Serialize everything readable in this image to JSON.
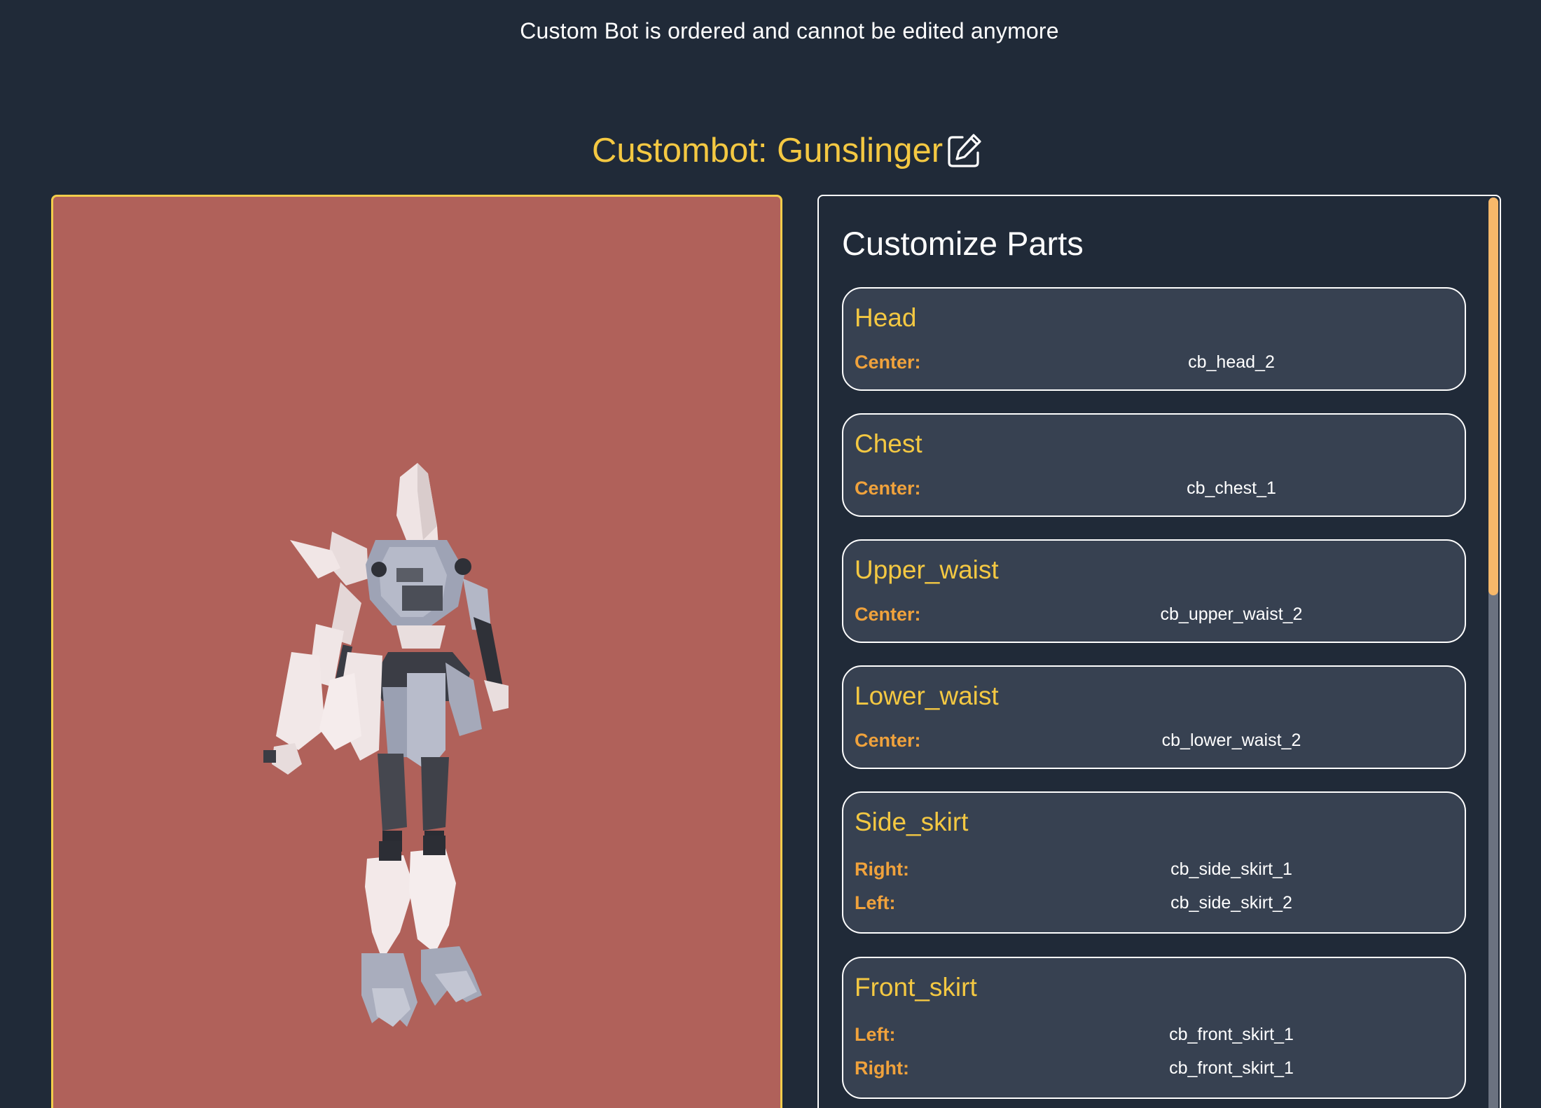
{
  "notice": "Custom Bot is ordered and cannot be edited anymore",
  "header": {
    "title": "Custombot: Gunslinger",
    "edit_icon": "pencil-square-icon"
  },
  "viewer": {
    "background": "#b0615a",
    "border_color": "#f2cd4b"
  },
  "panel": {
    "title": "Customize Parts",
    "parts": [
      {
        "name": "Head",
        "slots": [
          {
            "label": "Center:",
            "value": "cb_head_2"
          }
        ]
      },
      {
        "name": "Chest",
        "slots": [
          {
            "label": "Center:",
            "value": "cb_chest_1"
          }
        ]
      },
      {
        "name": "Upper_waist",
        "slots": [
          {
            "label": "Center:",
            "value": "cb_upper_waist_2"
          }
        ]
      },
      {
        "name": "Lower_waist",
        "slots": [
          {
            "label": "Center:",
            "value": "cb_lower_waist_2"
          }
        ]
      },
      {
        "name": "Side_skirt",
        "slots": [
          {
            "label": "Right:",
            "value": "cb_side_skirt_1"
          },
          {
            "label": "Left:",
            "value": "cb_side_skirt_2"
          }
        ]
      },
      {
        "name": "Front_skirt",
        "slots": [
          {
            "label": "Left:",
            "value": "cb_front_skirt_1"
          },
          {
            "label": "Right:",
            "value": "cb_front_skirt_1"
          }
        ]
      }
    ]
  },
  "colors": {
    "page_bg": "#202a38",
    "accent_yellow": "#f4c842",
    "label_orange": "#f0a23c",
    "card_bg": "#374151",
    "scroll_thumb": "#f7b86a"
  }
}
